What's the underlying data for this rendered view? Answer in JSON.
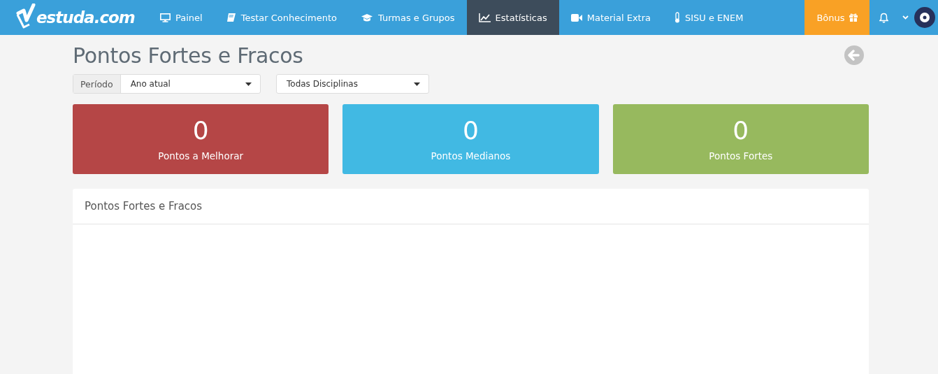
{
  "brand": {
    "name": "estuda.com"
  },
  "nav": [
    {
      "label": "Painel",
      "selected": false
    },
    {
      "label": "Testar Conhecimento",
      "selected": false
    },
    {
      "label": "Turmas e Grupos",
      "selected": false
    },
    {
      "label": "Estatísticas",
      "selected": true
    },
    {
      "label": "Material Extra",
      "selected": false
    },
    {
      "label": "SISU e ENEM",
      "selected": false
    }
  ],
  "bonus": {
    "label": "Bônus"
  },
  "title": "Pontos Fortes e Fracos",
  "filters": {
    "period_label": "Período",
    "period_value": "Ano atual",
    "discipline_value": "Todas Disciplinas"
  },
  "cards": [
    {
      "count": "0",
      "label": "Pontos a Melhorar",
      "color": "#b54646"
    },
    {
      "count": "0",
      "label": "Pontos Medianos",
      "color": "#41b9e3"
    },
    {
      "count": "0",
      "label": "Pontos Fortes",
      "color": "#97b95e"
    }
  ],
  "panel": {
    "title": "Pontos Fortes e Fracos"
  }
}
